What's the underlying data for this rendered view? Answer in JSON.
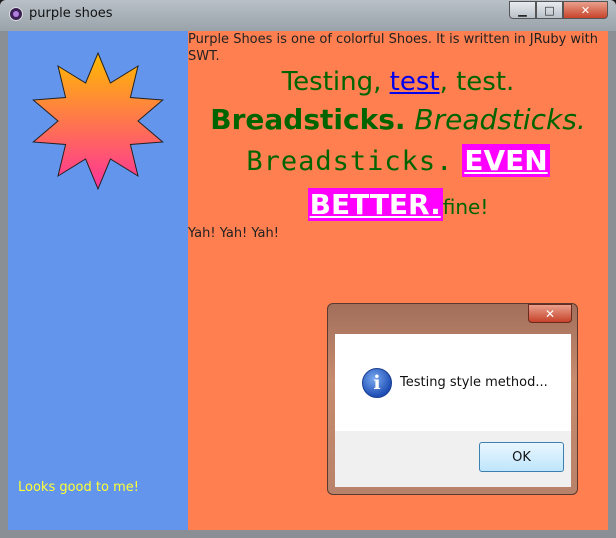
{
  "window": {
    "title": "purple shoes",
    "controls": {
      "minimize": "▁",
      "maximize": "□",
      "close": "✕"
    }
  },
  "left_panel": {
    "background": "#6495ed",
    "footer_text": "Looks good to me!",
    "star_gradient": [
      "#ffbb00",
      "#ff3399"
    ]
  },
  "right_panel": {
    "background": "#ff7f50",
    "intro": "Purple Shoes is one of colorful Shoes. It is written in JRuby with SWT.",
    "line1": {
      "a": "Testing, ",
      "link": "test",
      "b": ", test."
    },
    "line2": {
      "bold": "Breadsticks.",
      "italic": "Breadsticks."
    },
    "line3": {
      "mono": "Breadsticks.",
      "highlight": "EVEN"
    },
    "line4": {
      "highlight": "BETTER.",
      "tail": "fine!"
    },
    "yah": "Yah! Yah! Yah!"
  },
  "dialog": {
    "close": "✕",
    "icon": "i",
    "message": "Testing style method...",
    "ok_label": "OK"
  }
}
